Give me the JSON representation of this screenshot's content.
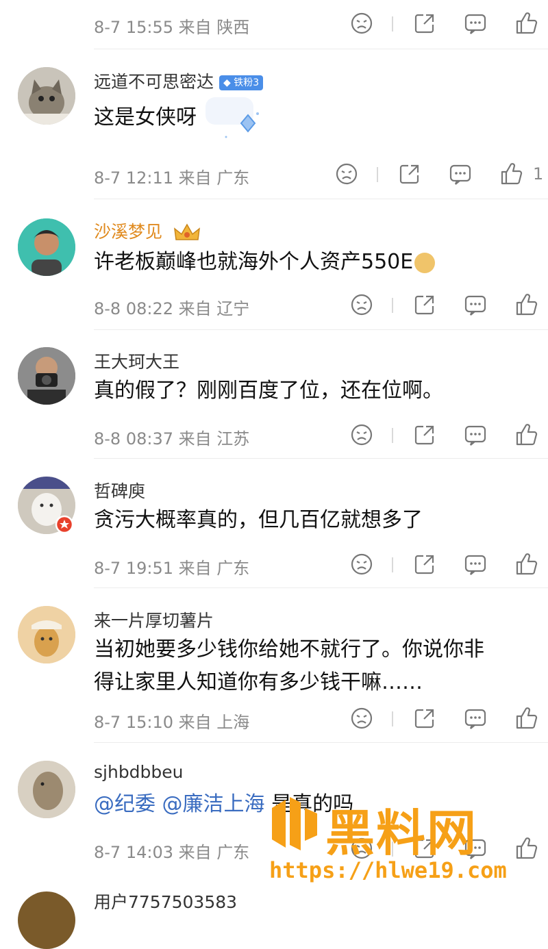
{
  "colors": {
    "accent": "#3a6cc0",
    "vip_name": "#e08a1e",
    "watermark": "#f6a017",
    "meta": "#8a8a8a"
  },
  "top_meta": {
    "date": "8-7 15:55",
    "from_label": "来自",
    "region": "陕西"
  },
  "comments": [
    {
      "user": "远道不可思密达",
      "badge": "铁粉3",
      "text": "这是女侠呀",
      "date": "8-7 12:11",
      "from_label": "来自",
      "region": "广东",
      "like_count": "1"
    },
    {
      "user": "沙溪梦见",
      "text": "许老板巅峰也就海外个人资产550E",
      "date": "8-8 08:22",
      "from_label": "来自",
      "region": "辽宁"
    },
    {
      "user": "王大珂大王",
      "text": "真的假了？刚刚百度了位，还在位啊。",
      "date": "8-8 08:37",
      "from_label": "来自",
      "region": "江苏"
    },
    {
      "user": "哲碑庾",
      "text": "贪污大概率真的，但几百亿就想多了",
      "date": "8-7 19:51",
      "from_label": "来自",
      "region": "广东"
    },
    {
      "user": "来一片厚切薯片",
      "text_line1": "当初她要多少钱你给她不就行了。你说你非",
      "text_line2": "得让家里人知道你有多少钱干嘛……",
      "date": "8-7 15:10",
      "from_label": "来自",
      "region": "上海"
    },
    {
      "user": "sjhbdbbeu",
      "mention1": "@纪委",
      "mention2": "@廉洁上海",
      "text_rest": "是真的吗",
      "date": "8-7 14:03",
      "from_label": "来自",
      "region": "广东"
    },
    {
      "user": "用户7757503583"
    }
  ],
  "icons": [
    "sad-face-icon",
    "share-icon",
    "comment-icon",
    "like-icon"
  ],
  "watermark": {
    "title": "黑料网",
    "url": "https://hlwe19.com"
  }
}
